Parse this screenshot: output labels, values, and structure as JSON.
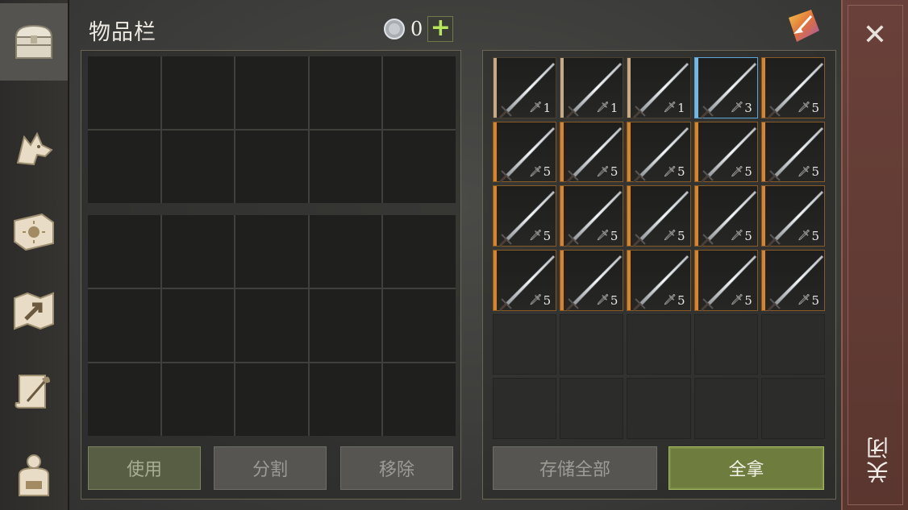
{
  "header": {
    "title": "物品栏",
    "currency_value": "0",
    "plus_label": "+"
  },
  "sidebar": {
    "tabs": [
      {
        "icon": "chest-icon",
        "active": true
      },
      {
        "icon": "wolf-icon",
        "active": false
      },
      {
        "icon": "sun-book-icon",
        "active": false
      },
      {
        "icon": "map-arrow-icon",
        "active": false
      },
      {
        "icon": "scroll-quill-icon",
        "active": false
      },
      {
        "icon": "character-backpack-icon",
        "active": false
      }
    ]
  },
  "left_panel": {
    "buttons": {
      "use": "使用",
      "split": "分割",
      "remove": "移除"
    }
  },
  "right_panel": {
    "items": [
      {
        "rarity": "tan",
        "count": "1"
      },
      {
        "rarity": "tan",
        "count": "1"
      },
      {
        "rarity": "tan",
        "count": "1"
      },
      {
        "rarity": "blue",
        "count": "3"
      },
      {
        "rarity": "orange",
        "count": "5"
      },
      {
        "rarity": "orange",
        "count": "5"
      },
      {
        "rarity": "orange",
        "count": "5"
      },
      {
        "rarity": "orange",
        "count": "5"
      },
      {
        "rarity": "orange",
        "count": "5"
      },
      {
        "rarity": "orange",
        "count": "5"
      },
      {
        "rarity": "orange",
        "count": "5"
      },
      {
        "rarity": "orange",
        "count": "5"
      },
      {
        "rarity": "orange",
        "count": "5"
      },
      {
        "rarity": "orange",
        "count": "5"
      },
      {
        "rarity": "orange",
        "count": "5"
      },
      {
        "rarity": "orange",
        "count": "5"
      },
      {
        "rarity": "orange",
        "count": "5"
      },
      {
        "rarity": "orange",
        "count": "5"
      },
      {
        "rarity": "orange",
        "count": "5"
      },
      {
        "rarity": "orange",
        "count": "5"
      }
    ],
    "buttons": {
      "store_all": "存储全部",
      "take_all": "全拿"
    }
  },
  "close": {
    "label": "关闭",
    "x": "✕"
  },
  "colors": {
    "orange_rarity": "#d9842a",
    "blue_rarity": "#74b8e0",
    "tan_rarity": "#c7aa84",
    "accent_green": "#b8e65a"
  }
}
